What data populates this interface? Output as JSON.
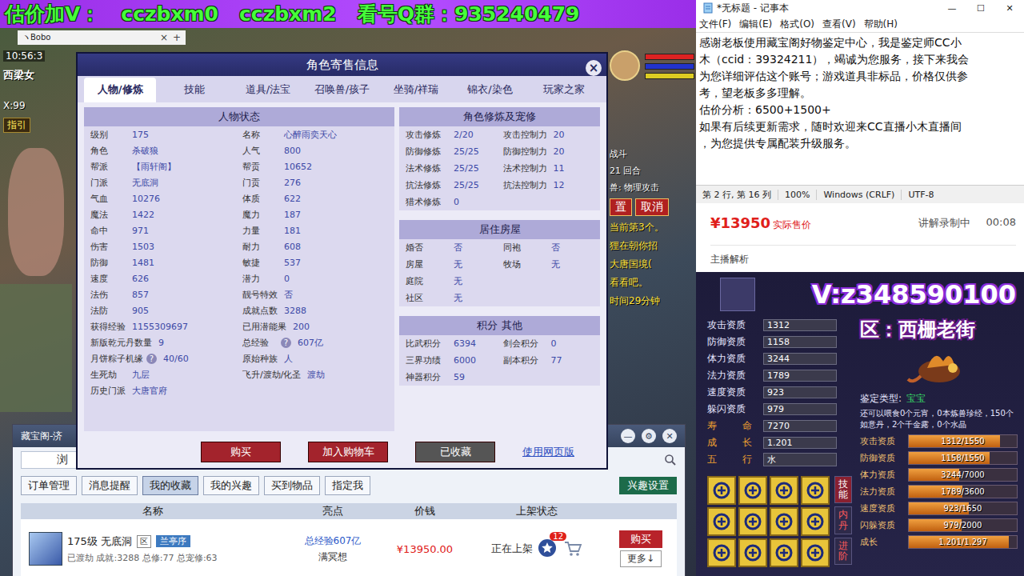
{
  "banner": {
    "parts": [
      "估价加V：",
      "cczbxm0",
      "cczbxm2",
      "看号Q群：935240479"
    ]
  },
  "browser_tab": {
    "title": "ヽBobo",
    "close": "×",
    "add": "+"
  },
  "game_hud": {
    "clock": "10:56:3",
    "map": "西梁女",
    "coords": "X:99",
    "guide": "指引"
  },
  "battle": {
    "lines": [
      "战斗",
      "21 回合",
      "兽: 物理攻击"
    ],
    "buttons": [
      "置",
      "取消"
    ],
    "notes": [
      "当前第3个。",
      "狸在朝你招",
      "大唐国境(",
      "看看吧。",
      "时间29分钟"
    ]
  },
  "dialog": {
    "title": "角色寄售信息",
    "close": "×",
    "tabs": [
      {
        "label": "人物/修炼",
        "selected": true
      },
      {
        "label": "技能",
        "selected": false
      },
      {
        "label": "道具/法宝",
        "selected": false
      },
      {
        "label": "召唤兽/孩子",
        "selected": false
      },
      {
        "label": "坐骑/祥瑞",
        "selected": false
      },
      {
        "label": "锦衣/染色",
        "selected": false
      },
      {
        "label": "玩家之家",
        "selected": false
      }
    ],
    "status": {
      "title": "人物状态",
      "rows": [
        [
          {
            "label": "级别",
            "value": "175"
          },
          {
            "label": "名称",
            "value": "心醉雨奕天心"
          }
        ],
        [
          {
            "label": "角色",
            "value": "杀破狼"
          },
          {
            "label": "人气",
            "value": "800"
          }
        ],
        [
          {
            "label": "帮派",
            "value": "【雨轩阁】"
          },
          {
            "label": "帮贡",
            "value": "10652"
          }
        ],
        [
          {
            "label": "门派",
            "value": "无底洞"
          },
          {
            "label": "门贡",
            "value": "276"
          }
        ],
        [
          {
            "label": "气血",
            "value": "10276"
          },
          {
            "label": "体质",
            "value": "622"
          }
        ],
        [
          {
            "label": "魔法",
            "value": "1422"
          },
          {
            "label": "魔力",
            "value": "187"
          }
        ],
        [
          {
            "label": "命中",
            "value": "971"
          },
          {
            "label": "力量",
            "value": "181"
          }
        ],
        [
          {
            "label": "伤害",
            "value": "1503"
          },
          {
            "label": "耐力",
            "value": "608"
          }
        ],
        [
          {
            "label": "防御",
            "value": "1481"
          },
          {
            "label": "敏捷",
            "value": "537"
          }
        ],
        [
          {
            "label": "速度",
            "value": "626"
          },
          {
            "label": "潜力",
            "value": "0"
          }
        ],
        [
          {
            "label": "法伤",
            "value": "857"
          },
          {
            "label": "靓号特效",
            "value": "否"
          }
        ],
        [
          {
            "label": "法防",
            "value": "905"
          },
          {
            "label": "成就点数",
            "value": "3288"
          }
        ],
        [
          {
            "label": "获得经验",
            "value": "1155309697"
          },
          {
            "label": "已用潜能果",
            "value": "200"
          }
        ],
        [
          {
            "label": "新版乾元丹数量",
            "value": "9"
          },
          {
            "label": "总经验",
            "value": "607亿",
            "help": "?"
          }
        ],
        [
          {
            "label": "月饼粽子机缘",
            "value": "40/60",
            "help": "?"
          },
          {
            "label": "原始种族",
            "value": "人"
          }
        ],
        [
          {
            "label": "生死劫",
            "value": "九层"
          },
          {
            "label": "飞升/渡劫/化圣",
            "value": "渡劫"
          }
        ],
        [
          {
            "label": "历史门派",
            "value": "大唐官府"
          }
        ]
      ]
    },
    "sections": [
      {
        "title": "角色修炼及宠修",
        "rows": [
          [
            {
              "label": "攻击修炼",
              "value": "2/20"
            },
            {
              "label": "攻击控制力",
              "value": "20"
            }
          ],
          [
            {
              "label": "防御修炼",
              "value": "25/25"
            },
            {
              "label": "防御控制力",
              "value": "20"
            }
          ],
          [
            {
              "label": "法术修炼",
              "value": "25/25"
            },
            {
              "label": "法术控制力",
              "value": "11"
            }
          ],
          [
            {
              "label": "抗法修炼",
              "value": "25/25"
            },
            {
              "label": "抗法控制力",
              "value": "12"
            }
          ],
          [
            {
              "label": "猎术修炼",
              "value": "0"
            }
          ]
        ]
      },
      {
        "title": "居住房屋",
        "rows": [
          [
            {
              "label": "婚否",
              "value": "否"
            },
            {
              "label": "同袍",
              "value": "否"
            }
          ],
          [
            {
              "label": "房屋",
              "value": "无"
            },
            {
              "label": "牧场",
              "value": "无"
            }
          ],
          [
            {
              "label": "庭院",
              "value": "无"
            }
          ],
          [
            {
              "label": "社区",
              "value": "无"
            }
          ]
        ]
      },
      {
        "title": "积分 其他",
        "rows": [
          [
            {
              "label": "比武积分",
              "value": "6394"
            },
            {
              "label": "剑会积分",
              "value": "0"
            }
          ],
          [
            {
              "label": "三界功绩",
              "value": "6000"
            },
            {
              "label": "副本积分",
              "value": "77"
            }
          ],
          [
            {
              "label": "神器积分",
              "value": "59"
            }
          ]
        ]
      }
    ],
    "buttons": [
      {
        "label": "购买",
        "kind": "primary"
      },
      {
        "label": "加入购物车",
        "kind": "primary"
      },
      {
        "label": "已收藏",
        "kind": "muted"
      }
    ],
    "link": "使用网页版"
  },
  "cbg": {
    "title": "藏宝阁-济",
    "controls": [
      "—",
      "⚙",
      "✕"
    ],
    "search_text": "浏",
    "tabs": [
      {
        "label": "订单管理",
        "selected": false
      },
      {
        "label": "消息提醒",
        "selected": false
      },
      {
        "label": "我的收藏",
        "selected": true
      },
      {
        "label": "我的兴趣",
        "selected": false
      },
      {
        "label": "买到物品",
        "selected": false
      },
      {
        "label": "指定我",
        "selected": false
      }
    ],
    "settings_button": "兴趣设置",
    "columns": [
      "名称",
      "亮点",
      "价钱",
      "上架状态"
    ],
    "rows": [
      {
        "name": "175级 无底洞",
        "tag": "区",
        "server": "兰亭序",
        "summary": "已渡劫 成就:3288 总修:77 总宠修:63",
        "highlight": "总经验607亿",
        "highlight2": "满冥想",
        "price": "¥13950.00",
        "status": "正在上架",
        "badge": "12",
        "buy": "购买",
        "more": "更多↓"
      }
    ]
  },
  "notepad": {
    "title": "*无标题 - 记事本",
    "controls": [
      "—",
      "☐",
      "✕"
    ],
    "menu": [
      "文件(F)",
      "编辑(E)",
      "格式(O)",
      "查看(V)",
      "帮助(H)"
    ],
    "lines": [
      "感谢老板使用藏宝阁好物鉴定中心，我是鉴定师CC小",
      "木（ccid：39324211），竭诚为您服务，接下来我会",
      "为您详细评估这个账号；游戏道具非标品，价格仅供参",
      "考，望老板多多理解。",
      "估价分析：6500+1500+",
      "如果有后续更新需求，随时欢迎来CC直播小木直播间",
      "，为您提供专属配装升级服务。"
    ],
    "status": [
      "第 2 行, 第 16 列",
      "100%",
      "Windows (CRLF)",
      "UTF-8"
    ]
  },
  "price": {
    "amount": "¥13950",
    "label": "实际售价",
    "recording": "讲解录制中",
    "time": "00:08",
    "section": "主播解析"
  },
  "pet": {
    "watermark": "V:z348590100",
    "zone": "区：西栅老街",
    "stats": [
      {
        "label": "攻击资质",
        "value": "1312",
        "kind": "plain"
      },
      {
        "label": "防御资质",
        "value": "1158",
        "kind": "plain"
      },
      {
        "label": "体力资质",
        "value": "3244",
        "kind": "plain"
      },
      {
        "label": "法力资质",
        "value": "1789",
        "kind": "plain"
      },
      {
        "label": "速度资质",
        "value": "923",
        "kind": "plain"
      },
      {
        "label": "躲闪资质",
        "value": "979",
        "kind": "plain"
      },
      {
        "label": "寿命",
        "value": "7270",
        "kind": "gold"
      },
      {
        "label": "成长",
        "value": "1.201",
        "kind": "gold"
      },
      {
        "label": "五行",
        "value": "水",
        "kind": "gold"
      }
    ],
    "type_label": "鉴定类型:",
    "type_value": "宝宝",
    "note": "还可以喂食0个元宵，0本炼兽珍经，150个如意丹，2个千金露，0个水晶",
    "bars": [
      {
        "label": "攻击资质",
        "reading": "1312/1550",
        "level": 0.846
      },
      {
        "label": "防御资质",
        "reading": "1158/1550",
        "level": 0.747
      },
      {
        "label": "体力资质",
        "reading": "3244/7000",
        "level": 0.463
      },
      {
        "label": "法力资质",
        "reading": "1789/3600",
        "level": 0.497
      },
      {
        "label": "速度资质",
        "reading": "923/1650",
        "level": 0.559
      },
      {
        "label": "闪躲资质",
        "reading": "979/2000",
        "level": 0.49
      },
      {
        "label": "成长",
        "reading": "1.201/1.297",
        "level": 0.926
      }
    ],
    "side_tabs": [
      {
        "label": "技能",
        "selected": true
      },
      {
        "label": "内丹",
        "selected": false
      },
      {
        "label": "进阶",
        "selected": false
      }
    ]
  }
}
